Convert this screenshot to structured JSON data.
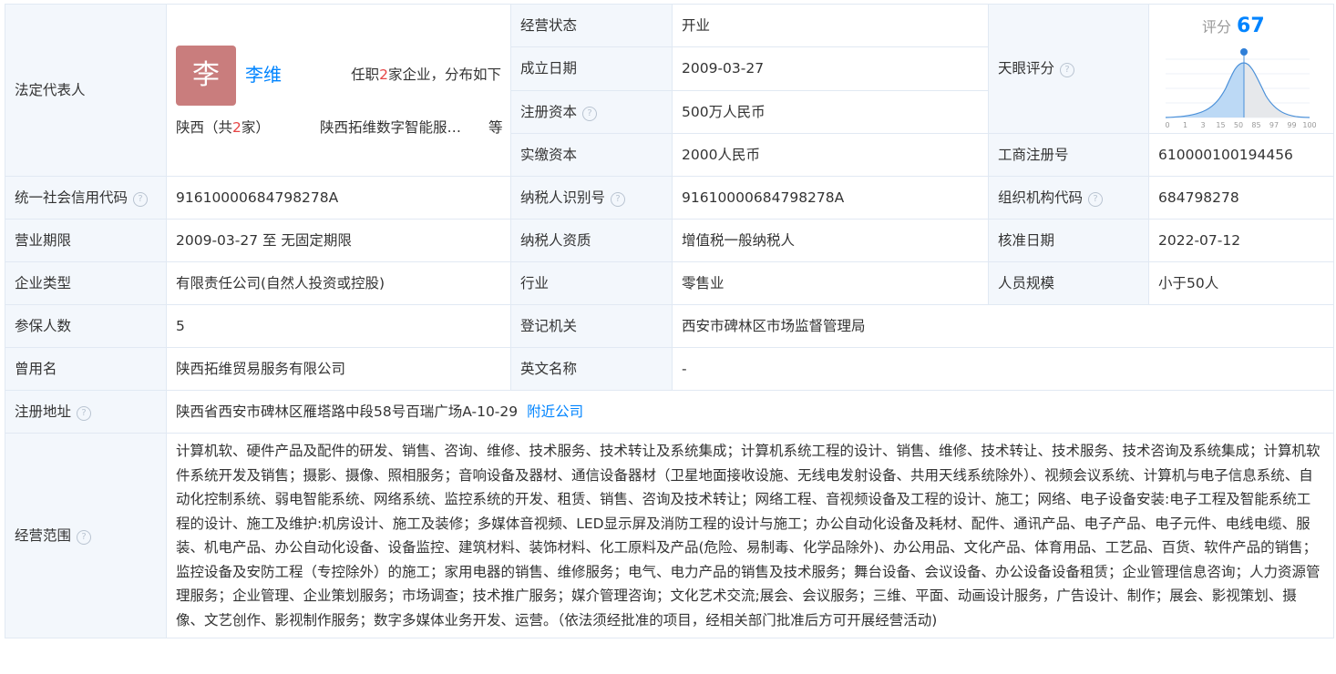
{
  "legal": {
    "label": "法定代表人",
    "avatar_char": "李",
    "name": "李维",
    "posts_pre": "任职",
    "posts_count": "2",
    "posts_post": "家企业，分布如下",
    "region_pre": "陕西（共",
    "region_count": "2",
    "region_post": "家）",
    "company": "陕西拓维数字智能服务有限公司",
    "more": "等"
  },
  "status": {
    "label": "经营状态",
    "value": "开业"
  },
  "founded": {
    "label": "成立日期",
    "value": "2009-03-27"
  },
  "reg_capital": {
    "label": "注册资本",
    "value": "500万人民币"
  },
  "paid_capital": {
    "label": "实缴资本",
    "value": "2000人民币"
  },
  "tianyan": {
    "label": "天眼评分",
    "score_label": "评分",
    "score": "67",
    "axis": [
      "0",
      "1",
      "3",
      "15",
      "50",
      "85",
      "97",
      "99",
      "100"
    ]
  },
  "biz_reg": {
    "label": "工商注册号",
    "value": "610000100194456"
  },
  "credit_code": {
    "label": "统一社会信用代码",
    "value": "91610000684798278A"
  },
  "taxpayer_id": {
    "label": "纳税人识别号",
    "value": "91610000684798278A"
  },
  "org_code": {
    "label": "组织机构代码",
    "value": "684798278"
  },
  "term": {
    "label": "营业期限",
    "value": "2009-03-27 至 无固定期限"
  },
  "tax_qual": {
    "label": "纳税人资质",
    "value": "增值税一般纳税人"
  },
  "approval": {
    "label": "核准日期",
    "value": "2022-07-12"
  },
  "ent_type": {
    "label": "企业类型",
    "value": "有限责任公司(自然人投资或控股)"
  },
  "industry": {
    "label": "行业",
    "value": "零售业"
  },
  "staff": {
    "label": "人员规模",
    "value": "小于50人"
  },
  "insured": {
    "label": "参保人数",
    "value": "5"
  },
  "authority": {
    "label": "登记机关",
    "value": "西安市碑林区市场监督管理局"
  },
  "former_name": {
    "label": "曾用名",
    "value": "陕西拓维贸易服务有限公司"
  },
  "en_name": {
    "label": "英文名称",
    "value": "-"
  },
  "address": {
    "label": "注册地址",
    "value": "陕西省西安市碑林区雁塔路中段58号百瑞广场A-10-29",
    "link": "附近公司"
  },
  "scope": {
    "label": "经营范围",
    "value": "计算机软、硬件产品及配件的研发、销售、咨询、维修、技术服务、技术转让及系统集成；计算机系统工程的设计、销售、维修、技术转让、技术服务、技术咨询及系统集成；计算机软件系统开发及销售；摄影、摄像、照相服务；音响设备及器材、通信设备器材（卫星地面接收设施、无线电发射设备、共用天线系统除外）、视频会议系统、计算机与电子信息系统、自动化控制系统、弱电智能系统、网络系统、监控系统的开发、租赁、销售、咨询及技术转让；网络工程、音视频设备及工程的设计、施工；网络、电子设备安装:电子工程及智能系统工程的设计、施工及维护:机房设计、施工及装修；多媒体音视频、LED显示屏及消防工程的设计与施工；办公自动化设备及耗材、配件、通讯产品、电子产品、电子元件、电线电缆、服装、机电产品、办公自动化设备、设备监控、建筑材料、装饰材料、化工原料及产品(危险、易制毒、化学品除外)、办公用品、文化产品、体育用品、工艺品、百货、软件产品的销售；监控设备及安防工程（专控除外）的施工；家用电器的销售、维修服务；电气、电力产品的销售及技术服务；舞台设备、会议设备、办公设备设备租赁；企业管理信息咨询；人力资源管理服务；企业管理、企业策划服务；市场调查；技术推广服务；媒介管理咨询；文化艺术交流;展会、会议服务；三维、平面、动画设计服务，广告设计、制作；展会、影视策划、摄像、文艺创作、影视制作服务；数字多媒体业务开发、运营。（依法须经批准的项目，经相关部门批准后方可开展经营活动)"
  }
}
